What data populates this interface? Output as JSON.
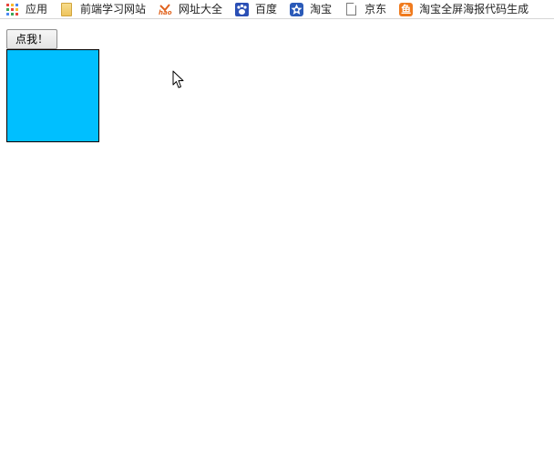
{
  "bookmarks": [
    {
      "label": "应用",
      "icon": "apps-grid-icon"
    },
    {
      "label": "前端学习网站",
      "icon": "folder-icon"
    },
    {
      "label": "网址大全",
      "icon": "hao123-icon"
    },
    {
      "label": "百度",
      "icon": "baidu-paw-icon"
    },
    {
      "label": "淘宝",
      "icon": "taobao-flower-icon"
    },
    {
      "label": "京东",
      "icon": "page-icon"
    },
    {
      "label": "淘宝全屏海报代码生成",
      "icon": "fish-icon",
      "icon_text": "鱼"
    }
  ],
  "hao_icon_text": "hao",
  "button": {
    "label": "点我！"
  },
  "box": {
    "color": "#00bfff"
  },
  "colors": {
    "apps_grid": [
      "#e8453c",
      "#f9bb2d",
      "#4a89f3",
      "#3aa757",
      "#e8453c",
      "#f9bb2d",
      "#4a89f3",
      "#3aa757",
      "#e8453c"
    ]
  }
}
